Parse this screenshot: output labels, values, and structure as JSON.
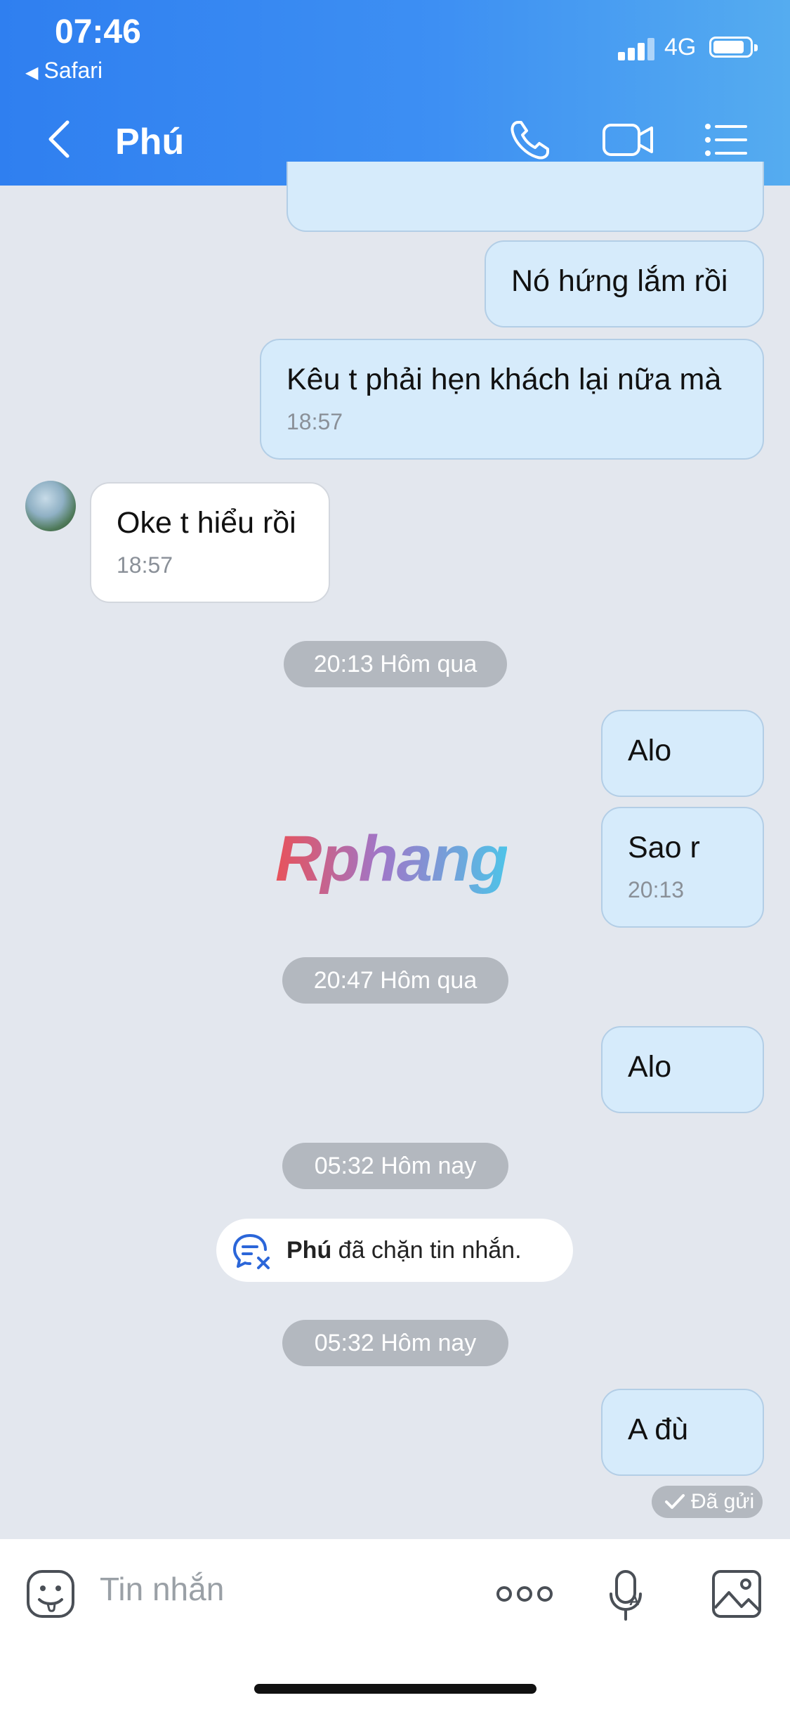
{
  "status_bar": {
    "time": "07:46",
    "back_app": "Safari",
    "network": "4G",
    "battery_level": 0.85
  },
  "header": {
    "title": "Phú",
    "icons": [
      "chevron-left-icon",
      "phone-icon",
      "video-camera-icon",
      "list-menu-icon"
    ]
  },
  "messages": [
    {
      "dir": "out",
      "text": "Nó hứng lắm rồi",
      "time": ""
    },
    {
      "dir": "out",
      "text": "Kêu t phải hẹn khách lại nữa mà",
      "time": "18:57"
    },
    {
      "dir": "in",
      "text": "Oke t hiểu rồi",
      "time": "18:57"
    },
    {
      "divider": "20:13 Hôm qua"
    },
    {
      "dir": "out",
      "text": "Alo",
      "time": ""
    },
    {
      "dir": "out",
      "text": "Sao r",
      "time": "20:13"
    },
    {
      "divider": "20:47 Hôm qua"
    },
    {
      "dir": "out",
      "text": "Alo",
      "time": ""
    },
    {
      "divider": "05:32 Hôm nay"
    },
    {
      "notice_name": "Phú",
      "notice_text": " đã chặn tin nhắn."
    },
    {
      "divider": "05:32 Hôm nay"
    },
    {
      "dir": "out",
      "text": "A đù",
      "time": ""
    }
  ],
  "sent_status": "Đã gửi",
  "watermark": "Rphang",
  "input": {
    "placeholder": "Tin nhắn"
  },
  "colors": {
    "header_gradient_start": "#2f7ff0",
    "header_gradient_end": "#55acf0",
    "chat_background": "#e3e7ee",
    "outgoing_bubble": "#d6ebfb",
    "incoming_bubble": "#ffffff",
    "divider_pill": "#b3b8bf"
  }
}
